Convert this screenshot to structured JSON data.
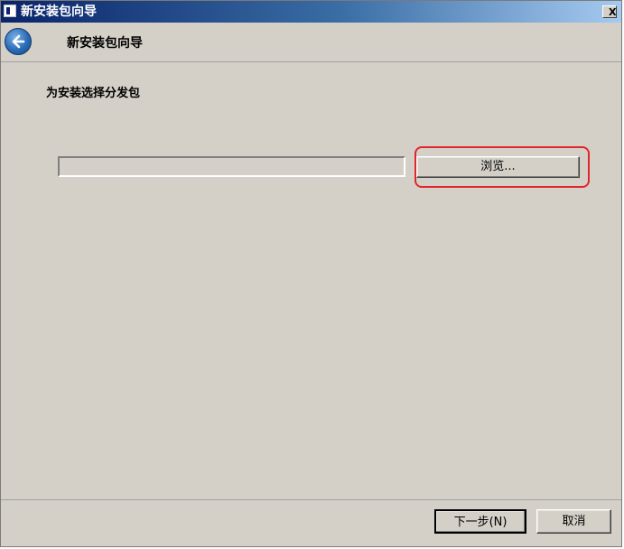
{
  "window": {
    "title": "新安装包向导",
    "close_label": "X"
  },
  "header": {
    "title": "新安装包向导"
  },
  "main": {
    "heading": "为安装选择分发包",
    "path_input_value": "",
    "browse_label": "浏览..."
  },
  "footer": {
    "next_label": "下一步(N)",
    "cancel_label": "取消"
  },
  "icons": {
    "app": "installer-app-icon",
    "back": "back-arrow-icon",
    "close": "close-icon"
  },
  "colors": {
    "titlebar_start": "#0a246a",
    "titlebar_end": "#a6caf0",
    "window_bg": "#d4d0c8",
    "highlight": "#e0262b"
  }
}
